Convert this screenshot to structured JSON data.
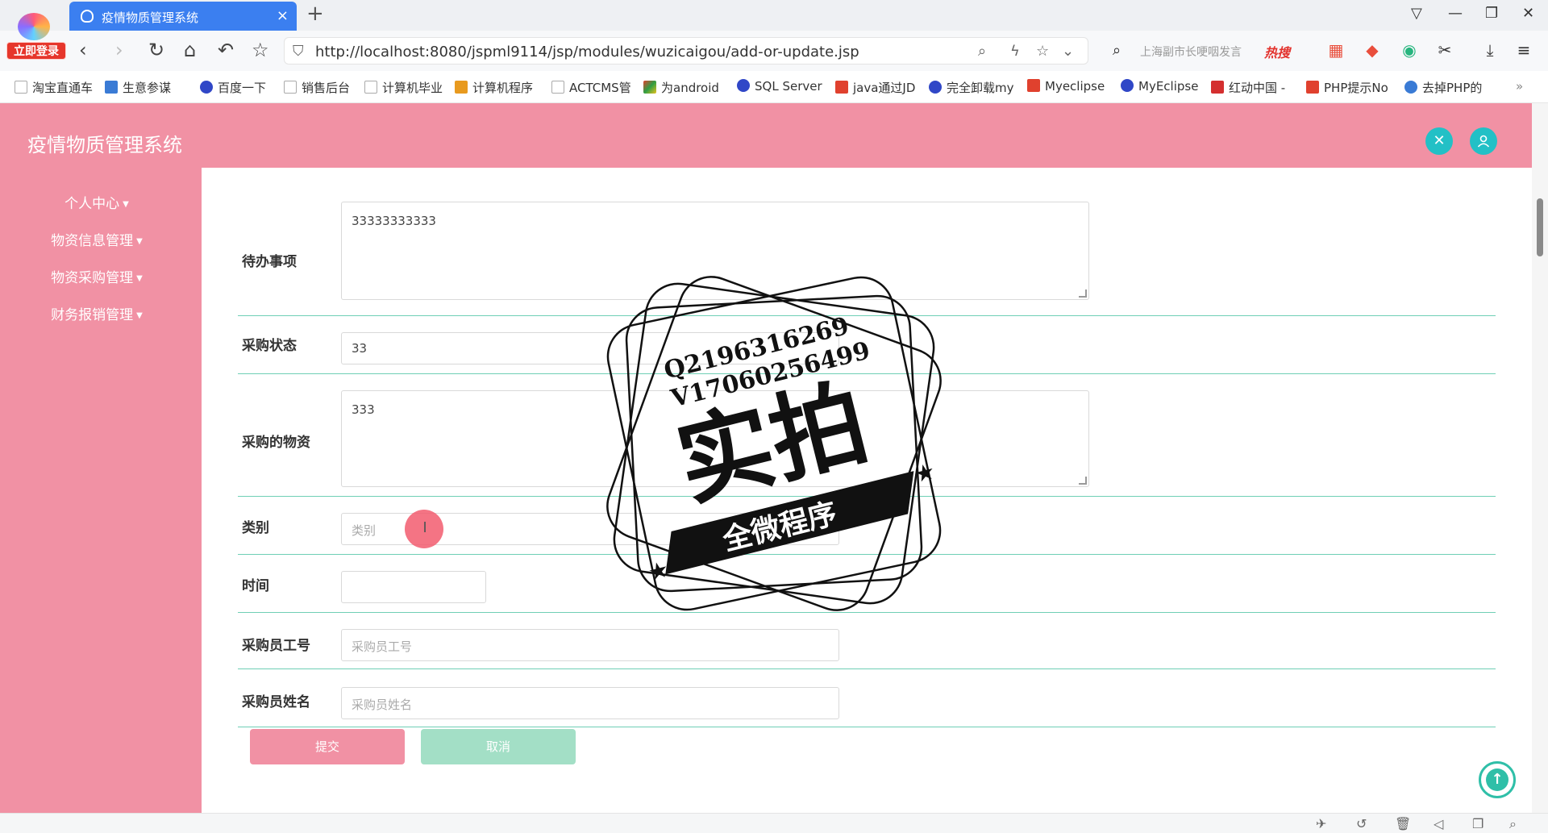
{
  "browser": {
    "login_badge": "立即登录",
    "tab_title": "疫情物质管理系统",
    "tab_close": "×",
    "new_tab": "+",
    "url": "http://localhost:8080/jspml9114/jsp/modules/wuzicaigou/add-or-update.jsp",
    "search_placeholder": "上海副市长哽咽发言",
    "search_hot": "热搜",
    "bookmarks": [
      {
        "label": "淘宝直通车",
        "color": "#ffffff"
      },
      {
        "label": "生意参谋",
        "color": "#3a7bd5"
      },
      {
        "label": "百度一下",
        "color": "#3047c7"
      },
      {
        "label": "销售后台",
        "color": "#ffffff"
      },
      {
        "label": "计算机毕业",
        "color": "#ffffff"
      },
      {
        "label": "计算机程序",
        "color": "#e89a1f"
      },
      {
        "label": "ACTCMS管",
        "color": "#ffffff"
      },
      {
        "label": "为android",
        "color": "#b0402a"
      },
      {
        "label": "SQL Server",
        "color": "#3047c7"
      },
      {
        "label": "java通过JD",
        "color": "#e0412e"
      },
      {
        "label": "完全卸载my",
        "color": "#3047c7"
      },
      {
        "label": "Myeclipse",
        "color": "#e0412e"
      },
      {
        "label": "MyEclipse",
        "color": "#3047c7"
      },
      {
        "label": "红动中国 -",
        "color": "#d42f2f"
      },
      {
        "label": "PHP提示No",
        "color": "#e0412e"
      },
      {
        "label": "去掉PHP的",
        "color": "#3a7bd5"
      }
    ],
    "bookmarks_more": "»"
  },
  "app": {
    "title": "疫情物质管理系统",
    "header_fullscreen_icon": "✕",
    "header_user_icon": "user-icon",
    "menu": [
      {
        "label": "个人中心"
      },
      {
        "label": "物资信息管理"
      },
      {
        "label": "物资采购管理"
      },
      {
        "label": "财务报销管理"
      }
    ]
  },
  "form": {
    "todo": {
      "label": "待办事项",
      "value": "33333333333"
    },
    "status": {
      "label": "采购状态",
      "value": "33"
    },
    "materials": {
      "label": "采购的物资",
      "value": "333"
    },
    "category": {
      "label": "类别",
      "placeholder": "类别"
    },
    "time": {
      "label": "时间",
      "value": ""
    },
    "buyer_id": {
      "label": "采购员工号",
      "placeholder": "采购员工号"
    },
    "buyer_name": {
      "label": "采购员姓名",
      "placeholder": "采购员姓名"
    },
    "submit_label": "提交",
    "cancel_label": "取消"
  },
  "colors": {
    "header": "#f191a4",
    "submit": "#f191a4",
    "cancel": "#a3dfc6",
    "accent": "#23c0c6"
  },
  "watermark": {
    "line1": "Q2196316269",
    "line2": "V17060256499",
    "main": "实拍",
    "ribbon": "全微程序"
  }
}
